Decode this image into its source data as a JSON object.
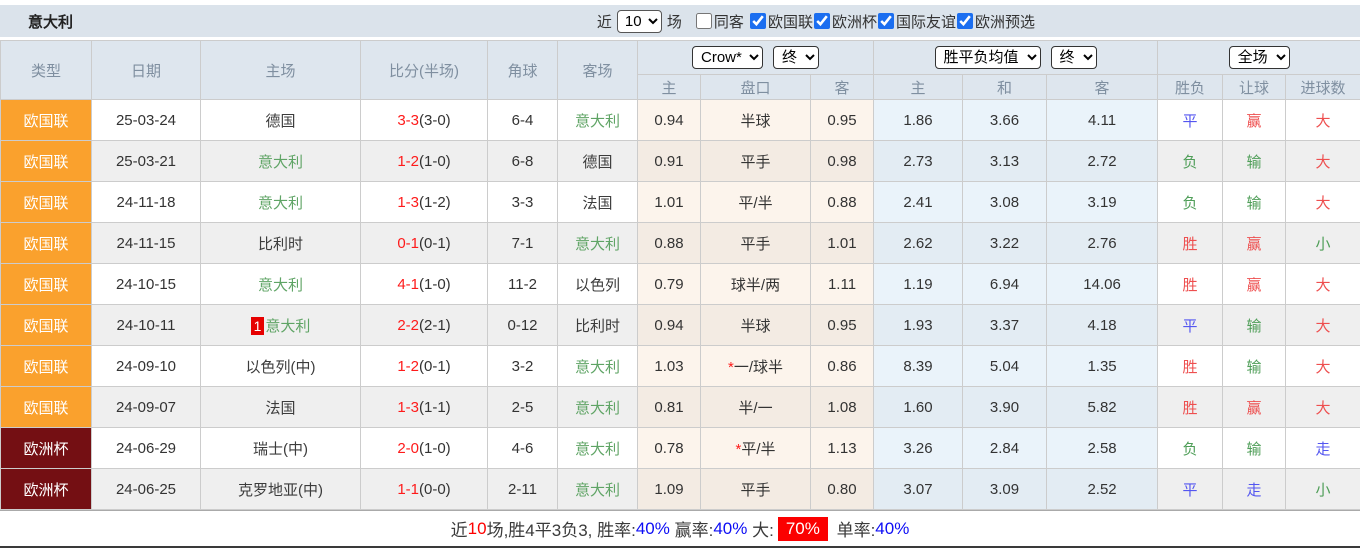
{
  "topbar": {
    "title": "意大利",
    "recent_label": "近",
    "recent_count": "10",
    "matches_label": "场",
    "same_opponent": {
      "label": "同客",
      "checked": false
    },
    "league_filters": [
      {
        "label": "欧国联",
        "checked": true
      },
      {
        "label": "欧洲杯",
        "checked": true
      },
      {
        "label": "国际友谊",
        "checked": true
      },
      {
        "label": "欧洲预选",
        "checked": true
      }
    ]
  },
  "table": {
    "main_headers": [
      "类型",
      "日期",
      "主场",
      "比分(半场)",
      "角球",
      "客场"
    ],
    "odds_group": {
      "company": "Crow*",
      "time": "终",
      "subcols": [
        "主",
        "盘口",
        "客"
      ]
    },
    "avg_group": {
      "company": "胜平负均值",
      "time": "终",
      "subcols": [
        "主",
        "和",
        "客"
      ]
    },
    "result_group": {
      "scope": "全场",
      "subcols": [
        "胜负",
        "让球",
        "进球数"
      ]
    },
    "rows": [
      {
        "league": "欧国联",
        "league_class": "nations",
        "date": "25-03-24",
        "home": "德国",
        "home_class": "dark",
        "home_badge": "",
        "score_ft": "3-3",
        "score_ht": "(3-0)",
        "corners": "6-4",
        "away": "意大利",
        "away_class": "green",
        "odds_home": "0.94",
        "handicap": "半球",
        "handicap_star": false,
        "odds_away": "0.95",
        "avg_home": "1.86",
        "avg_draw": "3.66",
        "avg_away": "4.11",
        "result": "平",
        "result_class": "blue",
        "handicap_result": "赢",
        "handicap_result_class": "red",
        "goals": "大",
        "goals_class": "red"
      },
      {
        "league": "欧国联",
        "league_class": "nations",
        "date": "25-03-21",
        "home": "意大利",
        "home_class": "green",
        "home_badge": "",
        "score_ft": "1-2",
        "score_ht": "(1-0)",
        "corners": "6-8",
        "away": "德国",
        "away_class": "dark",
        "odds_home": "0.91",
        "handicap": "平手",
        "handicap_star": false,
        "odds_away": "0.98",
        "avg_home": "2.73",
        "avg_draw": "3.13",
        "avg_away": "2.72",
        "result": "负",
        "result_class": "green",
        "handicap_result": "输",
        "handicap_result_class": "green",
        "goals": "大",
        "goals_class": "red"
      },
      {
        "league": "欧国联",
        "league_class": "nations",
        "date": "24-11-18",
        "home": "意大利",
        "home_class": "green",
        "home_badge": "",
        "score_ft": "1-3",
        "score_ht": "(1-2)",
        "corners": "3-3",
        "away": "法国",
        "away_class": "dark",
        "odds_home": "1.01",
        "handicap": "平/半",
        "handicap_star": false,
        "odds_away": "0.88",
        "avg_home": "2.41",
        "avg_draw": "3.08",
        "avg_away": "3.19",
        "result": "负",
        "result_class": "green",
        "handicap_result": "输",
        "handicap_result_class": "green",
        "goals": "大",
        "goals_class": "red"
      },
      {
        "league": "欧国联",
        "league_class": "nations",
        "date": "24-11-15",
        "home": "比利时",
        "home_class": "dark",
        "home_badge": "",
        "score_ft": "0-1",
        "score_ht": "(0-1)",
        "corners": "7-1",
        "away": "意大利",
        "away_class": "green",
        "odds_home": "0.88",
        "handicap": "平手",
        "handicap_star": false,
        "odds_away": "1.01",
        "avg_home": "2.62",
        "avg_draw": "3.22",
        "avg_away": "2.76",
        "result": "胜",
        "result_class": "red",
        "handicap_result": "赢",
        "handicap_result_class": "red",
        "goals": "小",
        "goals_class": "green"
      },
      {
        "league": "欧国联",
        "league_class": "nations",
        "date": "24-10-15",
        "home": "意大利",
        "home_class": "green",
        "home_badge": "",
        "score_ft": "4-1",
        "score_ht": "(1-0)",
        "corners": "11-2",
        "away": "以色列",
        "away_class": "dark",
        "odds_home": "0.79",
        "handicap": "球半/两",
        "handicap_star": false,
        "odds_away": "1.11",
        "avg_home": "1.19",
        "avg_draw": "6.94",
        "avg_away": "14.06",
        "result": "胜",
        "result_class": "red",
        "handicap_result": "赢",
        "handicap_result_class": "red",
        "goals": "大",
        "goals_class": "red"
      },
      {
        "league": "欧国联",
        "league_class": "nations",
        "date": "24-10-11",
        "home": "意大利",
        "home_class": "green",
        "home_badge": "1",
        "score_ft": "2-2",
        "score_ht": "(2-1)",
        "corners": "0-12",
        "away": "比利时",
        "away_class": "dark",
        "odds_home": "0.94",
        "handicap": "半球",
        "handicap_star": false,
        "odds_away": "0.95",
        "avg_home": "1.93",
        "avg_draw": "3.37",
        "avg_away": "4.18",
        "result": "平",
        "result_class": "blue",
        "handicap_result": "输",
        "handicap_result_class": "green",
        "goals": "大",
        "goals_class": "red"
      },
      {
        "league": "欧国联",
        "league_class": "nations",
        "date": "24-09-10",
        "home": "以色列(中)",
        "home_class": "dark",
        "home_badge": "",
        "score_ft": "1-2",
        "score_ht": "(0-1)",
        "corners": "3-2",
        "away": "意大利",
        "away_class": "green",
        "odds_home": "1.03",
        "handicap": "一/球半",
        "handicap_star": true,
        "odds_away": "0.86",
        "avg_home": "8.39",
        "avg_draw": "5.04",
        "avg_away": "1.35",
        "result": "胜",
        "result_class": "red",
        "handicap_result": "输",
        "handicap_result_class": "green",
        "goals": "大",
        "goals_class": "red"
      },
      {
        "league": "欧国联",
        "league_class": "nations",
        "date": "24-09-07",
        "home": "法国",
        "home_class": "dark",
        "home_badge": "",
        "score_ft": "1-3",
        "score_ht": "(1-1)",
        "corners": "2-5",
        "away": "意大利",
        "away_class": "green",
        "odds_home": "0.81",
        "handicap": "半/一",
        "handicap_star": false,
        "odds_away": "1.08",
        "avg_home": "1.60",
        "avg_draw": "3.90",
        "avg_away": "5.82",
        "result": "胜",
        "result_class": "red",
        "handicap_result": "赢",
        "handicap_result_class": "red",
        "goals": "大",
        "goals_class": "red"
      },
      {
        "league": "欧洲杯",
        "league_class": "euro",
        "date": "24-06-29",
        "home": "瑞士(中)",
        "home_class": "dark",
        "home_badge": "",
        "score_ft": "2-0",
        "score_ht": "(1-0)",
        "corners": "4-6",
        "away": "意大利",
        "away_class": "green",
        "odds_home": "0.78",
        "handicap": "平/半",
        "handicap_star": true,
        "odds_away": "1.13",
        "avg_home": "3.26",
        "avg_draw": "2.84",
        "avg_away": "2.58",
        "result": "负",
        "result_class": "green",
        "handicap_result": "输",
        "handicap_result_class": "green",
        "goals": "走",
        "goals_class": "blue"
      },
      {
        "league": "欧洲杯",
        "league_class": "euro",
        "date": "24-06-25",
        "home": "克罗地亚(中)",
        "home_class": "dark",
        "home_badge": "",
        "score_ft": "1-1",
        "score_ht": "(0-0)",
        "corners": "2-11",
        "away": "意大利",
        "away_class": "green",
        "odds_home": "1.09",
        "handicap": "平手",
        "handicap_star": false,
        "odds_away": "0.80",
        "avg_home": "3.07",
        "avg_draw": "3.09",
        "avg_away": "2.52",
        "result": "平",
        "result_class": "blue",
        "handicap_result": "走",
        "handicap_result_class": "blue",
        "goals": "小",
        "goals_class": "green"
      }
    ],
    "footer_segments": [
      {
        "text": "近",
        "style": "dark"
      },
      {
        "text": "10",
        "style": "red"
      },
      {
        "text": "场,胜4平3负3, 胜率:",
        "style": "dark"
      },
      {
        "text": "40%",
        "style": "blue"
      },
      {
        "text": " 赢率:",
        "style": "dark"
      },
      {
        "text": "40%",
        "style": "blue"
      },
      {
        "text": " 大:",
        "style": "dark"
      },
      {
        "text": "70%",
        "style": "red-badge"
      },
      {
        "text": " 单率:",
        "style": "dark"
      },
      {
        "text": "40%",
        "style": "blue"
      }
    ]
  }
}
